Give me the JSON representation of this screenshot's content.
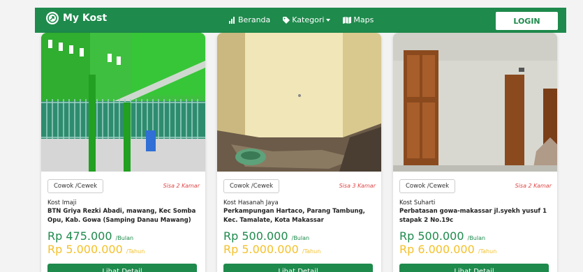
{
  "navbar": {
    "brand": "My Kost",
    "links": [
      {
        "label": "Beranda",
        "icon": "bar-chart-icon"
      },
      {
        "label": "Kategori",
        "icon": "tag-icon"
      },
      {
        "label": "Maps",
        "icon": "map-icon"
      }
    ],
    "login_label": "LOGIN",
    "bg_color": "#1e8a4c"
  },
  "cards": [
    {
      "gender": "Cowok /Cewek",
      "availability": "Sisa 2 Kamar",
      "name": "Kost Imaji",
      "address": "BTN Griya Rezki Abadi, mawang, Kec Somba Opu, Kab. Gowa (Samping Danau Mawang)",
      "price_month": "Rp 475.000",
      "per_month": "/Bulan",
      "price_year": "Rp 5.000.000",
      "per_year": "/Tahun",
      "button": "Lihat Detail"
    },
    {
      "gender": "Cowok /Cewek",
      "availability": "Sisa 3 Kamar",
      "name": "Kost Hasanah Jaya",
      "address": "Perkampungan Hartaco, Parang Tambung, Kec. Tamalate, Kota Makassar",
      "price_month": "Rp 500.000",
      "per_month": "/Bulan",
      "price_year": "Rp 5.000.000",
      "per_year": "/Tahun",
      "button": "Lihat Detail"
    },
    {
      "gender": "Cowok /Cewek",
      "availability": "Sisa 2 Kamar",
      "name": "Kost Suharti",
      "address": "Perbatasan gowa-makassar jl.syekh yusuf 1 stapak 2 No.19c",
      "price_month": "Rp 500.000",
      "per_month": "/Bulan",
      "price_year": "Rp 6.000.000",
      "per_year": "/Tahun",
      "button": "Lihat Detail"
    }
  ]
}
